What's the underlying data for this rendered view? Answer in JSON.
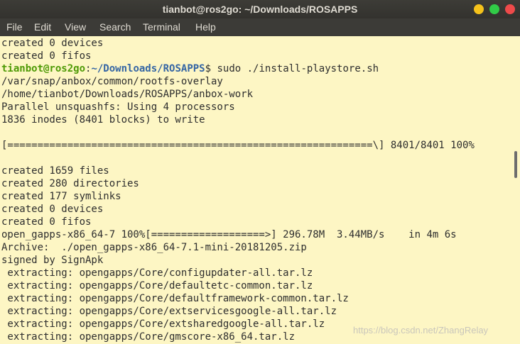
{
  "window": {
    "title": "tianbot@ros2go: ~/Downloads/ROSAPPS",
    "accent_colors": {
      "close": "#ee4a4a",
      "minimize": "#f5c21b",
      "maximize": "#31cb47"
    }
  },
  "menu": [
    "File",
    "Edit",
    "View",
    "Search",
    "Terminal",
    "Help"
  ],
  "prompt": {
    "user_host": "tianbot@ros2go",
    "sep": ":",
    "path": "~/Downloads/ROSAPPS",
    "symbol": "$",
    "command": " sudo ./install-playstore.sh"
  },
  "lines_before": [
    "created 0 devices",
    "created 0 fifos"
  ],
  "lines_after": [
    "/var/snap/anbox/common/rootfs-overlay",
    "/home/tianbot/Downloads/ROSAPPS/anbox-work",
    "Parallel unsquashfs: Using 4 processors",
    "1836 inodes (8401 blocks) to write",
    "",
    "[=============================================================\\] 8401/8401 100%",
    "",
    "created 1659 files",
    "created 280 directories",
    "created 177 symlinks",
    "created 0 devices",
    "created 0 fifos",
    "open_gapps-x86_64-7 100%[===================>] 296.78M  3.44MB/s    in 4m 6s",
    "Archive:  ./open_gapps-x86_64-7.1-mini-20181205.zip",
    "signed by SignApk",
    " extracting: opengapps/Core/configupdater-all.tar.lz",
    " extracting: opengapps/Core/defaultetc-common.tar.lz",
    " extracting: opengapps/Core/defaultframework-common.tar.lz",
    " extracting: opengapps/Core/extservicesgoogle-all.tar.lz",
    " extracting: opengapps/Core/extsharedgoogle-all.tar.lz",
    " extracting: opengapps/Core/gmscore-x86_64.tar.lz"
  ],
  "watermark": "https://blog.csdn.net/ZhangRelay",
  "colors": {
    "background": "#fdf6c4",
    "text": "#2e2e2e",
    "user_host": "#4e9a06",
    "path": "#3465a4"
  }
}
